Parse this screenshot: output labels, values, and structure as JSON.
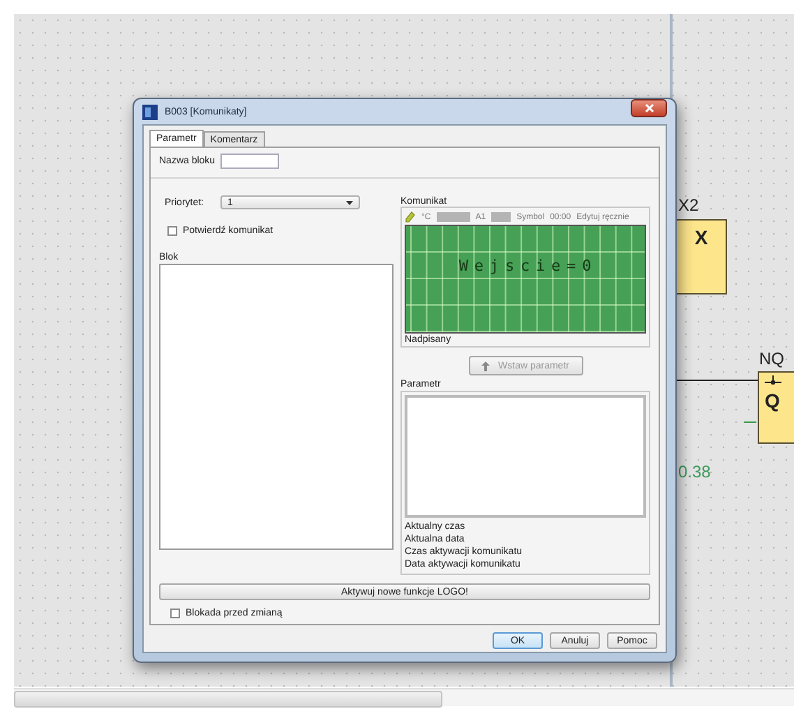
{
  "dialog": {
    "title": "B003 [Komunikaty]",
    "tabs": [
      {
        "label": "Parametr",
        "selected": true
      },
      {
        "label": "Komentarz",
        "selected": false
      }
    ],
    "block_name": {
      "label": "Nazwa bloku"
    },
    "priority": {
      "label": "Priorytet:",
      "value": "1"
    },
    "confirm": {
      "label": "Potwierdź komunikat",
      "checked": false
    },
    "block_group": {
      "title": "Blok"
    },
    "message_group": {
      "title": "Komunikat",
      "toolbar": [
        {
          "kind": "icon"
        },
        {
          "kind": "text",
          "text": "°C"
        },
        {
          "kind": "field"
        },
        {
          "kind": "text",
          "text": "A1"
        },
        {
          "kind": "field"
        },
        {
          "kind": "text",
          "text": "Symbol"
        },
        {
          "kind": "text",
          "text": "00:00"
        },
        {
          "kind": "text",
          "text": "Edytuj ręcznie"
        }
      ],
      "display": {
        "text": "Wejscie=0"
      },
      "status": "Nadpisany"
    },
    "insert_button": {
      "label": "Wstaw parametr",
      "disabled": true
    },
    "parameter_group": {
      "title": "Parametr",
      "items": [
        "Aktualny czas",
        "Aktualna data",
        "Czas aktywacji komunikatu",
        "Data aktywacji komunikatu"
      ]
    },
    "activate_button": "Aktywuj nowe funkcje LOGO!",
    "lock": {
      "label": "Blokada przed zmianą",
      "checked": false
    },
    "buttons": [
      {
        "label": "OK",
        "default": true
      },
      {
        "label": "Anuluj",
        "default": false
      },
      {
        "label": "Pomoc",
        "default": false
      }
    ]
  },
  "diagram": {
    "blocks": [
      {
        "kind": "input",
        "name": "X2",
        "symbol": "X"
      },
      {
        "kind": "output",
        "name": "NQ",
        "symbol": "Q"
      }
    ],
    "readings": [
      "0.38"
    ]
  }
}
